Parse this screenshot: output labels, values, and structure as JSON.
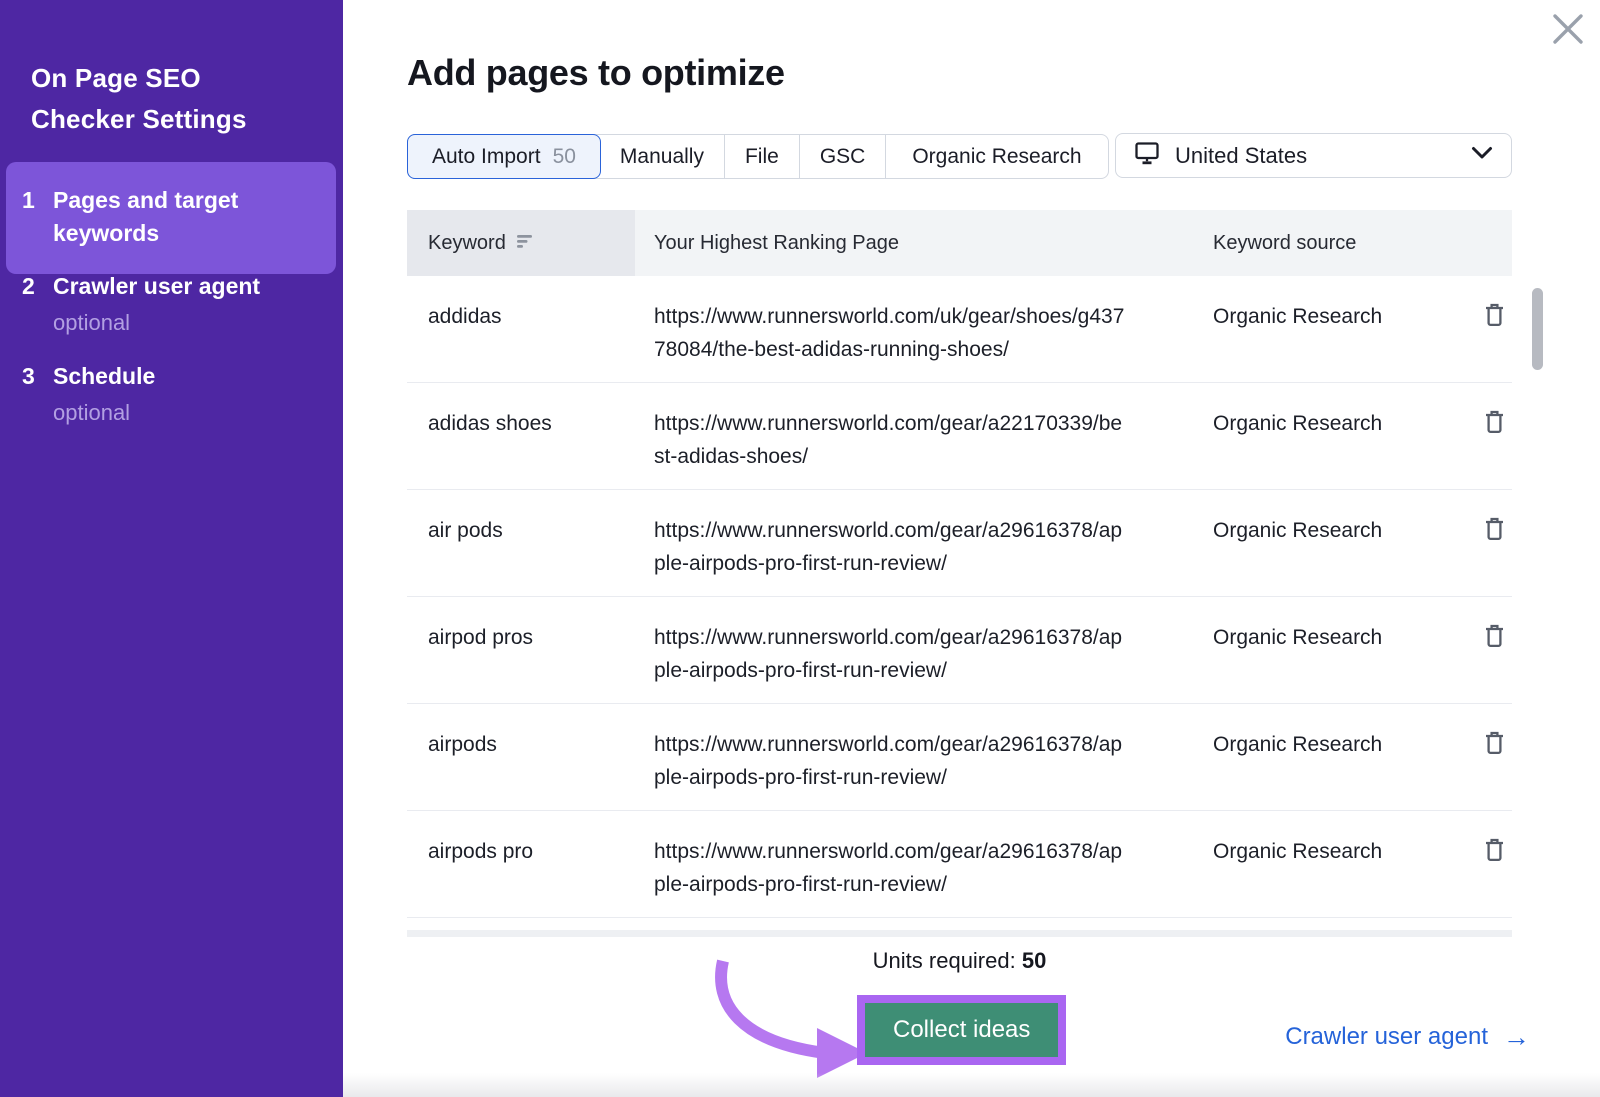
{
  "sidebar": {
    "title": "On Page SEO Checker Settings",
    "steps": [
      {
        "number": "1",
        "label": "Pages and target keywords",
        "optional": "",
        "active": true
      },
      {
        "number": "2",
        "label": "Crawler user agent",
        "optional": "optional",
        "active": false
      },
      {
        "number": "3",
        "label": "Schedule",
        "optional": "optional",
        "active": false
      }
    ]
  },
  "header": {
    "title": "Add pages to optimize"
  },
  "tabs": [
    {
      "label": "Auto Import",
      "count": "50",
      "selected": true
    },
    {
      "label": "Manually",
      "selected": false
    },
    {
      "label": "File",
      "selected": false
    },
    {
      "label": "GSC",
      "selected": false
    },
    {
      "label": "Organic Research",
      "selected": false
    }
  ],
  "region_select": {
    "value": "United States"
  },
  "table": {
    "columns": [
      "Keyword",
      "Your Highest Ranking Page",
      "Keyword source"
    ],
    "rows": [
      {
        "keyword": "addidas",
        "url": "https://www.runnersworld.com/uk/gear/shoes/g43778084/the-best-adidas-running-shoes/",
        "source": "Organic Research"
      },
      {
        "keyword": "adidas shoes",
        "url": "https://www.runnersworld.com/gear/a22170339/best-adidas-shoes/",
        "source": "Organic Research"
      },
      {
        "keyword": "air pods",
        "url": "https://www.runnersworld.com/gear/a29616378/apple-airpods-pro-first-run-review/",
        "source": "Organic Research"
      },
      {
        "keyword": "airpod pros",
        "url": "https://www.runnersworld.com/gear/a29616378/apple-airpods-pro-first-run-review/",
        "source": "Organic Research"
      },
      {
        "keyword": "airpods",
        "url": "https://www.runnersworld.com/gear/a29616378/apple-airpods-pro-first-run-review/",
        "source": "Organic Research"
      },
      {
        "keyword": "airpods pro",
        "url": "https://www.runnersworld.com/gear/a29616378/apple-airpods-pro-first-run-review/",
        "source": "Organic Research"
      }
    ]
  },
  "footer": {
    "units_label": "Units required:",
    "units_value": "50",
    "collect_button": "Collect ideas",
    "next_link": "Crawler user agent",
    "link_arrow": "→"
  },
  "colors": {
    "sidebar_purple": "#4e27a3",
    "active_step_purple": "#7d55d9",
    "selected_tab_blue": "#2a63d9",
    "button_green": "#3e8e75",
    "annotation_purple": "#a966f1",
    "link_blue": "#2563d9"
  }
}
